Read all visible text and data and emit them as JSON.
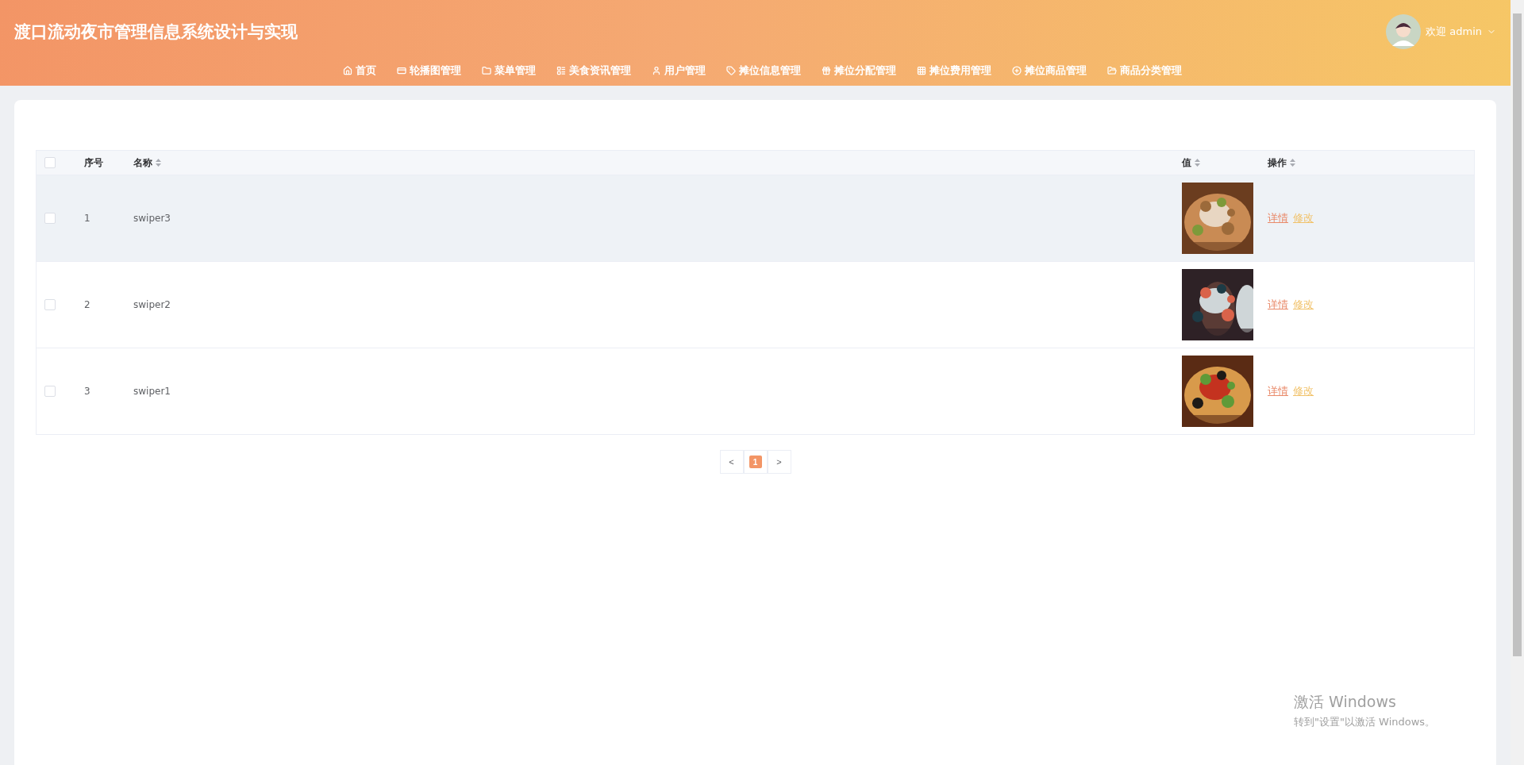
{
  "header": {
    "title": "渡口流动夜市管理信息系统设计与实现",
    "user": {
      "greeting": "欢迎 admin"
    }
  },
  "nav": [
    {
      "label": "首页"
    },
    {
      "label": "轮播图管理"
    },
    {
      "label": "菜单管理"
    },
    {
      "label": "美食资讯管理"
    },
    {
      "label": "用户管理"
    },
    {
      "label": "摊位信息管理"
    },
    {
      "label": "摊位分配管理"
    },
    {
      "label": "摊位费用管理"
    },
    {
      "label": "摊位商品管理"
    },
    {
      "label": "商品分类管理"
    }
  ],
  "table": {
    "select_all": {
      "checked": false
    },
    "columns": [
      {
        "label": "序号",
        "sortable": false
      },
      {
        "label": "名称",
        "sortable": true
      },
      {
        "label": "值",
        "sortable": true
      },
      {
        "label": "操作",
        "sortable": true
      }
    ],
    "rows": [
      {
        "index": "1",
        "name": "swiper3",
        "value": {
          "kind": "picture"
        },
        "actions": [
          "详情",
          "修改"
        ],
        "checked": false,
        "highlighted": true
      },
      {
        "index": "2",
        "name": "swiper2",
        "value": {
          "kind": "picture"
        },
        "actions": [
          "详情",
          "修改"
        ],
        "checked": false,
        "highlighted": false
      },
      {
        "index": "3",
        "name": "swiper1",
        "value": {
          "kind": "picture"
        },
        "actions": [
          "详情",
          "修改"
        ],
        "checked": false,
        "highlighted": false
      }
    ]
  },
  "pagination": {
    "prev": "<",
    "pages": [
      {
        "label": "1",
        "selected": true
      }
    ],
    "next": ">"
  },
  "activation_notice": {
    "title": "激活 Windows",
    "hint": "转到\"设置\"以激活 Windows。"
  }
}
